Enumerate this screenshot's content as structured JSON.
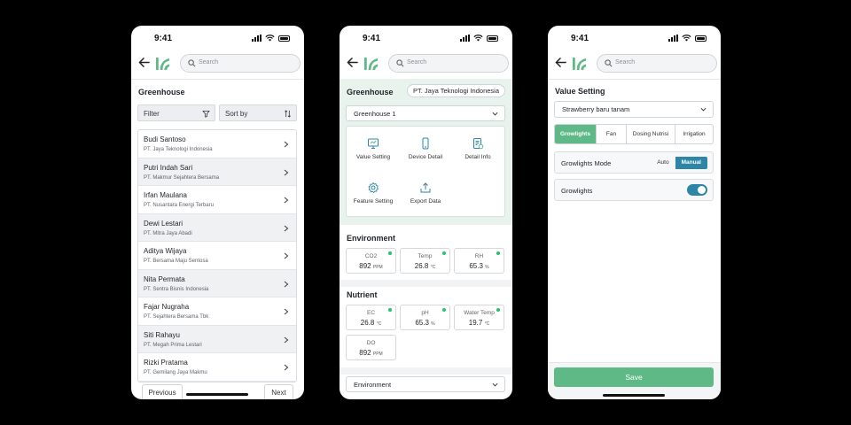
{
  "status": {
    "time": "9:41"
  },
  "search": {
    "placeholder": "Search"
  },
  "screen1": {
    "title": "Greenhouse",
    "filter_label": "Filter",
    "sort_label": "Sort by",
    "rows": [
      {
        "name": "Budi Santoso",
        "company": "PT. Jaya Teknologi Indonesia"
      },
      {
        "name": "Putri Indah Sari",
        "company": "PT. Makmur Sejahtera Bersama"
      },
      {
        "name": "Irfan Maulana",
        "company": "PT. Nusantara Energi Terbaru"
      },
      {
        "name": "Dewi Lestari",
        "company": "PT. Mitra Jaya Abadi"
      },
      {
        "name": "Aditya Wijaya",
        "company": "PT. Bersama Maju Sentosa"
      },
      {
        "name": "Nita Permata",
        "company": "PT. Sentra Bisnis Indonesia"
      },
      {
        "name": "Fajar Nugraha",
        "company": "PT. Sejahtera Bersama Tbk"
      },
      {
        "name": "Siti Rahayu",
        "company": "PT. Megah Prima Lestari"
      },
      {
        "name": "Rizki Pratama",
        "company": "PT. Gemilang Jaya Makmu"
      }
    ],
    "prev_label": "Previous",
    "next_label": "Next"
  },
  "screen2": {
    "title": "Greenhouse",
    "company_pill": "PT. Jaya Teknologi Indonesia",
    "greenhouse_select": "Greenhouse 1",
    "menu": {
      "value_setting": "Value Setting",
      "device_detail": "Device Detail",
      "detail_info": "Detail Info",
      "feature_setting": "Feature Setting",
      "export_data": "Export Data"
    },
    "environment_title": "Environment",
    "environment": [
      {
        "label": "CO2",
        "value": "892",
        "unit": "PPM"
      },
      {
        "label": "Temp",
        "value": "26.8",
        "unit": "°C"
      },
      {
        "label": "RH",
        "value": "65.3",
        "unit": "%"
      }
    ],
    "nutrient_title": "Nutrient",
    "nutrient": [
      {
        "label": "EC",
        "value": "26.8",
        "unit": "°C"
      },
      {
        "label": "pH",
        "value": "65.3",
        "unit": "%"
      },
      {
        "label": "Water Temp",
        "value": "19.7",
        "unit": "°C"
      },
      {
        "label": "DO",
        "value": "892",
        "unit": "PPM"
      }
    ],
    "bottom_select": "Environment",
    "status_color": "#23c26b"
  },
  "screen3": {
    "title": "Value Setting",
    "plant_select": "Strawberry baru tanam",
    "tabs": [
      "Growlights",
      "Fan",
      "Dosing Nutrisi",
      "Irrigation"
    ],
    "mode_label": "Growlights Mode",
    "mode_auto": "Auto",
    "mode_manual": "Manual",
    "toggle_label": "Growlights",
    "save_label": "Save",
    "accent": "#5fb986",
    "toggle_color": "#2d85a8"
  }
}
